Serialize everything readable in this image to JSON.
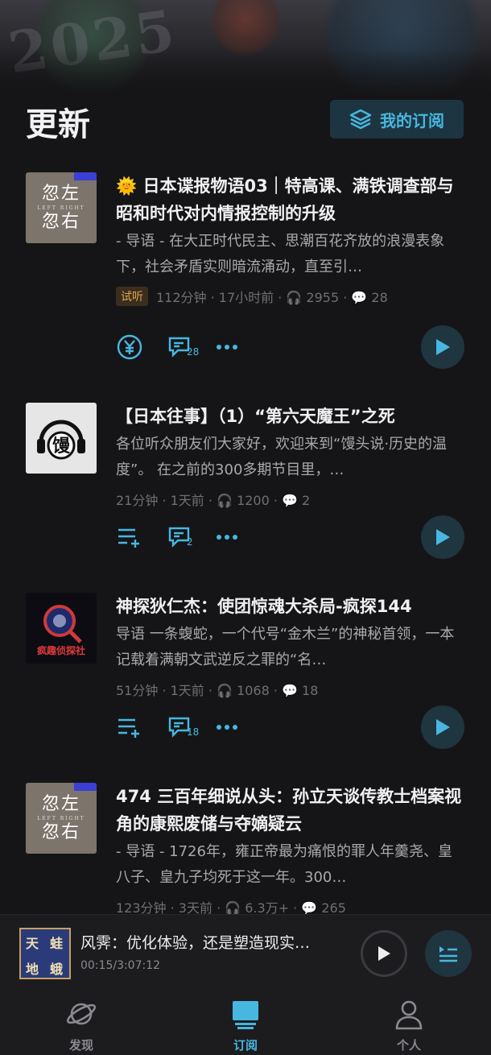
{
  "header": {
    "title": "更新",
    "subscribe_label": "我的订阅"
  },
  "episodes": [
    {
      "cover": "左右",
      "title": "🌞 日本谍报物语03｜特高课、满铁调查部与昭和时代对内情报控制的升级",
      "desc": "- 导语 - 在大正时代民主、思潮百花齐放的浪漫表象下，社会矛盾实则暗流涌动，直至引…",
      "trial": "试听",
      "meta": "112分钟 · 17小时前 · 🎧 2955 · 💬 28",
      "comments": "28"
    },
    {
      "cover": "馒",
      "title": "【日本往事】（1）“第六天魔王”之死",
      "desc": "各位听众朋友们大家好，欢迎来到“馒头说·历史的温度”。 在之前的300多期节目里，…",
      "meta": "21分钟 · 1天前 · 🎧 1200 · 💬 2",
      "comments": "2"
    },
    {
      "cover": "疯趣侦探社",
      "title": "神探狄仁杰：使团惊魂大杀局-疯探144",
      "desc": "导语 一条蝮蛇，一个代号“金木兰”的神秘首领，一本记载着满朝文武逆反之罪的“名…",
      "meta": "51分钟 · 1天前 · 🎧 1068 · 💬 18",
      "comments": "18"
    },
    {
      "cover": "左右",
      "title": "474 三百年细说从头：孙立天谈传教士档案视角的康熙废储与夺嫡疑云",
      "desc": "- 导语 - 1726年，雍正帝最为痛恨的罪人年羹尧、皇八子、皇九子均死于这一年。300…",
      "meta": "123分钟 · 3天前 · 🎧 6.3万+ · 💬 265"
    }
  ],
  "player": {
    "title": "风霁：优化体验，还是塑造现实…",
    "time": "00:15/3:07:12",
    "cover_chars": [
      "天",
      "蛙",
      "地",
      "蛾"
    ]
  },
  "tabs": [
    {
      "label": "发现"
    },
    {
      "label": "订阅"
    },
    {
      "label": "个人"
    }
  ],
  "colors": {
    "accent": "#48b7e0",
    "background": "#151517"
  }
}
